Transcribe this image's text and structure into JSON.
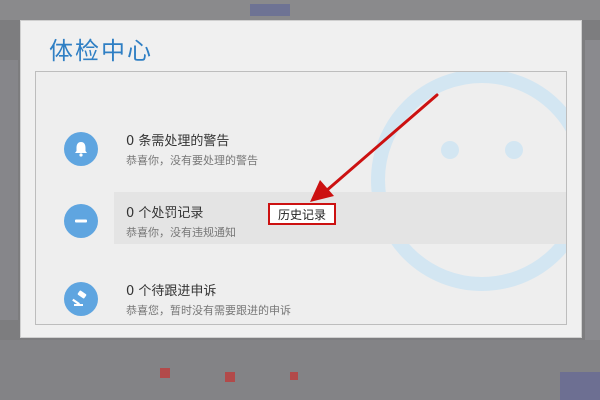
{
  "modal": {
    "title": "体检中心",
    "items": [
      {
        "icon": "bell-icon",
        "title": "0 条需处理的警告",
        "subtitle": "恭喜你，没有要处理的警告"
      },
      {
        "icon": "minus-circle-icon",
        "title": "0 个处罚记录",
        "subtitle": "恭喜你，没有违规通知",
        "button": "历史记录"
      },
      {
        "icon": "gavel-icon",
        "title": "0 个待跟进申诉",
        "subtitle": "恭喜您，暂时没有需要跟进的申诉"
      }
    ]
  },
  "colors": {
    "title": "#2f7fc4",
    "icon": "#5fa5e0",
    "highlight_border": "#cc1111",
    "arrow": "#cc1111"
  }
}
